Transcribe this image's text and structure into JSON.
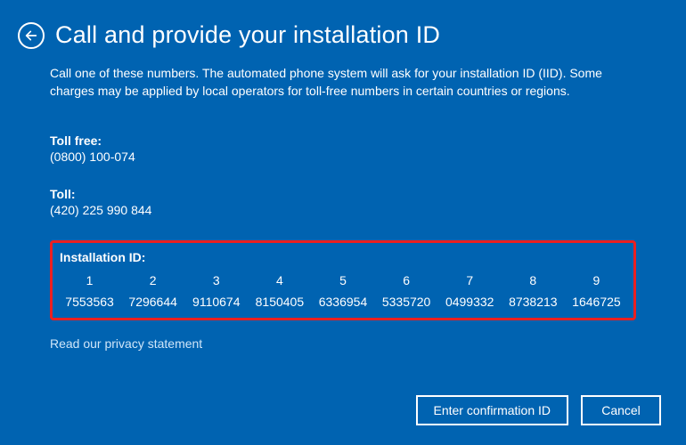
{
  "title": "Call and provide your installation ID",
  "description": "Call one of these numbers. The automated phone system will ask for your installation ID (IID). Some charges may be applied by local operators for toll-free numbers in certain countries or regions.",
  "toll_free": {
    "label": "Toll free:",
    "value": "(0800) 100-074"
  },
  "toll": {
    "label": "Toll:",
    "value": "(420) 225 990 844"
  },
  "installation_id": {
    "label": "Installation ID:",
    "groups": [
      {
        "index": "1",
        "value": "7553563"
      },
      {
        "index": "2",
        "value": "7296644"
      },
      {
        "index": "3",
        "value": "9110674"
      },
      {
        "index": "4",
        "value": "8150405"
      },
      {
        "index": "5",
        "value": "6336954"
      },
      {
        "index": "6",
        "value": "5335720"
      },
      {
        "index": "7",
        "value": "0499332"
      },
      {
        "index": "8",
        "value": "8738213"
      },
      {
        "index": "9",
        "value": "1646725"
      }
    ]
  },
  "privacy_link": "Read our privacy statement",
  "buttons": {
    "primary": "Enter confirmation ID",
    "cancel": "Cancel"
  },
  "colors": {
    "background": "#0063b1",
    "highlight_border": "#eb2020",
    "text": "#ffffff"
  }
}
